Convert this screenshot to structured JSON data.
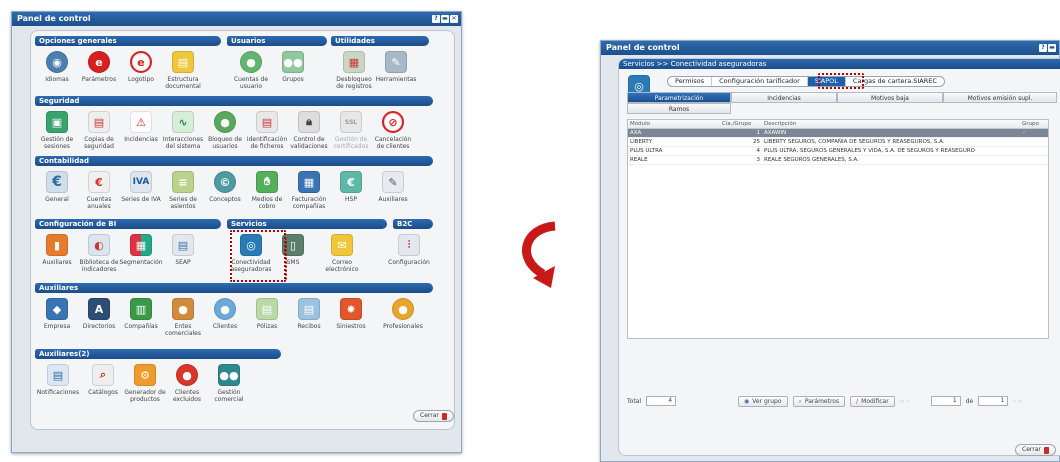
{
  "left": {
    "title": "Panel de control",
    "sections": {
      "opciones_generales": "Opciones generales",
      "usuarios": "Usuarios",
      "utilidades": "Utilidades",
      "seguridad": "Seguridad",
      "contabilidad": "Contabilidad",
      "configuracion_bi": "Configuración de BI",
      "servicios": "Servicios",
      "b2c": "B2C",
      "auxiliares": "Auxiliares",
      "auxiliares2": "Auxiliares(2)"
    },
    "items": {
      "idiomas": "Idiomas",
      "parametros": "Parámetros",
      "logotipo": "Logotipo",
      "estructura": "Estructura\ndocumental",
      "cuentas_usuario": "Cuentas de\nusuario",
      "grupos": "Grupos",
      "desbloqueo": "Desbloqueo\nde registros",
      "herramientas": "Herramientas",
      "gestion_sesiones": "Gestión de\nsesiones",
      "copias": "Copias de\nseguridad",
      "incidencias": "Incidencias",
      "interacciones": "Interacciones\ndel sistema",
      "bloqueo": "Bloqueo de\nusuarios",
      "identificacion": "Identificación\nde ficheros",
      "control": "Control de\nvalidaciones",
      "certificados": "Gestión de\ncertificados",
      "cancelacion": "Cancelación\nde clientes",
      "general": "General",
      "cuentas_anuales": "Cuentas\nanuales",
      "series_iva": "Series de IVA",
      "series_asientos": "Series de\nasientos",
      "conceptos": "Conceptos",
      "medios_cobro": "Medios de\ncobro",
      "facturacion": "Facturación\ncompañías",
      "hsp": "HSP",
      "auxiliares_conta": "Auxiliares",
      "auxiliares_bi": "Auxiliares",
      "biblioteca": "Biblioteca de\nindicadores",
      "segmentacion": "Segmentación",
      "seap": "SEAP",
      "conectividad": "Conectividad\naseguradoras",
      "sms": "SMS",
      "correo": "Correo\nelectrónico",
      "configuracion": "Configuración",
      "empresa": "Empresa",
      "directorios": "Directorios",
      "companias": "Compañías",
      "entes": "Entes\ncomerciales",
      "clientes": "Clientes",
      "polizas": "Pólizas",
      "recibos": "Recibos",
      "siniestros": "Siniestros",
      "profesionales": "Profesionales",
      "notificaciones": "Notificaciones",
      "catalogos": "Catálogos",
      "generador": "Generador de\nproductos",
      "clientes_excluidos": "Clientes\nexcluidos",
      "gestion_comercial": "Gestión\ncomercial"
    },
    "icon_text": {
      "iva": "IVA",
      "euro": "€",
      "ssl": "SSL"
    },
    "close_label": "Cerrar"
  },
  "right": {
    "title": "Panel de control",
    "breadcrumb": "Servicios >> Conectividad aseguradoras",
    "segments": [
      "Permisos",
      "Configuración tarificador",
      "SIAPOL",
      "Cargas de cartera.SIAREC"
    ],
    "tabs": [
      "Parametrización",
      "Incidencias",
      "Motivos baja",
      "Motivos emisión supl.",
      "Ramos"
    ],
    "columns": [
      "Módulo",
      "Cía./Grupo",
      "Descripción",
      "Grupo"
    ],
    "rows": [
      {
        "modulo": "AXA",
        "cia": "1",
        "desc": "AXAWIN",
        "grupo": "✓"
      },
      {
        "modulo": "LIBERTY",
        "cia": "25",
        "desc": "LIBERTY SEGUROS, COMPAÑIA DE SEGUROS Y REASEGUROS, S.A.",
        "grupo": ""
      },
      {
        "modulo": "PLUS ULTRA",
        "cia": "4",
        "desc": "PLUS ULTRA, SEGUROS GENERALES Y VIDA, S.A. DE SEGUROS Y REASEGURO",
        "grupo": ""
      },
      {
        "modulo": "REALE",
        "cia": "3",
        "desc": "REALE SEGUROS GENERALES, S.A.",
        "grupo": ""
      }
    ],
    "footer": {
      "total_label": "Total",
      "total_value": "4",
      "ver_grupo": "Ver grupo",
      "parametros": "Parámetros",
      "modificar": "Modificar",
      "page": "1",
      "de": "de",
      "pages": "1"
    },
    "close_label": "Cerrar"
  }
}
